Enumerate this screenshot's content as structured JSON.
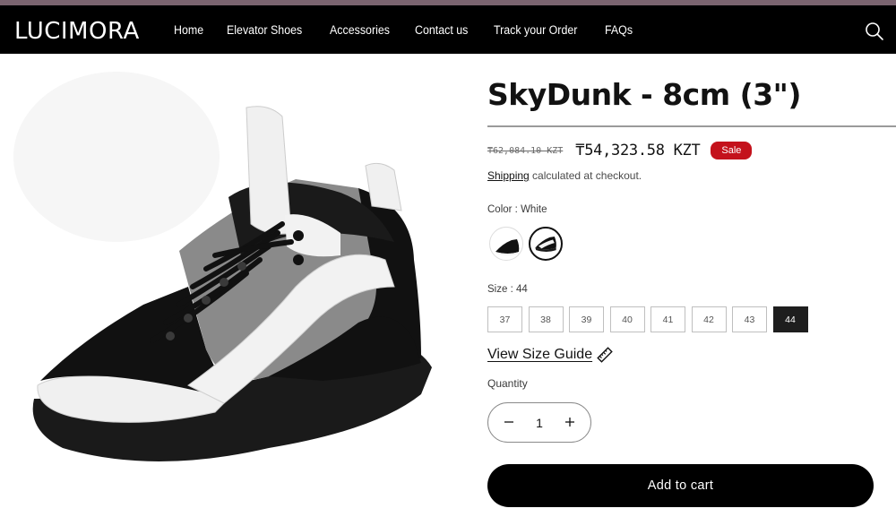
{
  "brand": {
    "logo": "LUCIMORA"
  },
  "nav": {
    "items": [
      "Home",
      "Elevator Shoes",
      "Accessories",
      "Contact us",
      "Track your Order",
      "FAQs"
    ],
    "search_icon": "search-icon"
  },
  "product": {
    "title": "SkyDunk - 8cm (3\")",
    "price_old": "₸62,084.10 KZT",
    "price_new": "₸54,323.58 KZT",
    "badge": "Sale",
    "shipping_link": "Shipping",
    "shipping_text": " calculated at checkout.",
    "color_label": "Color : White",
    "size_label": "Size : 44",
    "sizes": [
      "37",
      "38",
      "39",
      "40",
      "41",
      "42",
      "43",
      "44"
    ],
    "selected_size": "44",
    "size_guide": "View Size Guide",
    "quantity_label": "Quantity",
    "quantity": "1",
    "add_to_cart": "Add to cart"
  },
  "colors": {
    "header_bg": "#000000",
    "top_strip": "#7a6470",
    "sale_badge": "#c4121c",
    "button_bg": "#000000"
  }
}
